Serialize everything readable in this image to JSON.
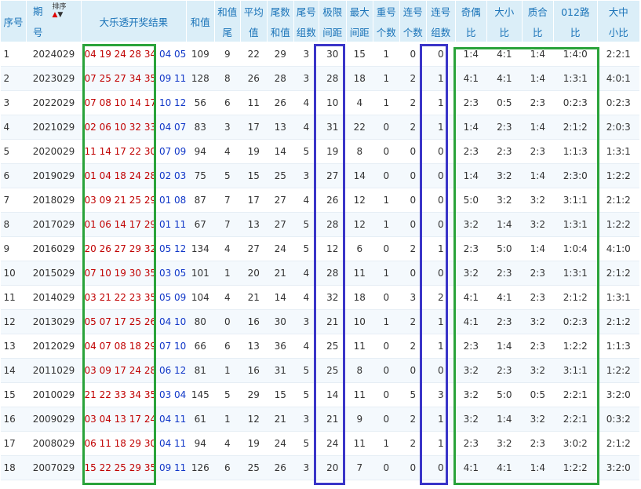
{
  "headers": {
    "seq": "序号",
    "period_top": "期",
    "period_bottom": "号",
    "sort_label": "排序",
    "result": "大乐透开奖结果",
    "sum": "和值",
    "sum_tail_top": "和值",
    "sum_tail_bottom": "尾",
    "avg_top": "平均",
    "avg_bottom": "值",
    "tail_sum_top": "尾数",
    "tail_sum_bottom": "和值",
    "tail_grp_top": "尾号",
    "tail_grp_bottom": "组数",
    "limit_top": "极限",
    "limit_bottom": "间距",
    "max_top": "最大",
    "max_bottom": "间距",
    "repeat_top": "重号",
    "repeat_bottom": "个数",
    "consec_top": "连号",
    "consec_bottom": "个数",
    "consec_grp_top": "连号",
    "consec_grp_bottom": "组数",
    "oddeven_top": "奇偶",
    "oddeven_bottom": "比",
    "bigsmall_top": "大小",
    "bigsmall_bottom": "比",
    "primecomp_top": "质合",
    "primecomp_bottom": "比",
    "route_top": "012路",
    "route_bottom": "比",
    "bms_top": "大中",
    "bms_bottom": "小比"
  },
  "rows": [
    {
      "seq": "1",
      "period": "2024029",
      "front": "04 19 24 28 34",
      "back": "04 05",
      "sum": "109",
      "sum_tail": "9",
      "avg": "22",
      "tail_sum": "29",
      "tail_grp": "3",
      "limit": "30",
      "max": "15",
      "repeat": "1",
      "consec": "0",
      "consec_grp": "0",
      "oe": "1:4",
      "bs": "4:1",
      "pc": "1:4",
      "route": "1:4:0",
      "bms": "2:2:1"
    },
    {
      "seq": "2",
      "period": "2023029",
      "front": "07 25 27 34 35",
      "back": "09 11",
      "sum": "128",
      "sum_tail": "8",
      "avg": "26",
      "tail_sum": "28",
      "tail_grp": "3",
      "limit": "28",
      "max": "18",
      "repeat": "1",
      "consec": "2",
      "consec_grp": "1",
      "oe": "4:1",
      "bs": "4:1",
      "pc": "1:4",
      "route": "1:3:1",
      "bms": "4:0:1"
    },
    {
      "seq": "3",
      "period": "2022029",
      "front": "07 08 10 14 17",
      "back": "10 12",
      "sum": "56",
      "sum_tail": "6",
      "avg": "11",
      "tail_sum": "26",
      "tail_grp": "4",
      "limit": "10",
      "max": "4",
      "repeat": "1",
      "consec": "2",
      "consec_grp": "1",
      "oe": "2:3",
      "bs": "0:5",
      "pc": "2:3",
      "route": "0:2:3",
      "bms": "0:2:3"
    },
    {
      "seq": "4",
      "period": "2021029",
      "front": "02 06 10 32 33",
      "back": "04 07",
      "sum": "83",
      "sum_tail": "3",
      "avg": "17",
      "tail_sum": "13",
      "tail_grp": "4",
      "limit": "31",
      "max": "22",
      "repeat": "0",
      "consec": "2",
      "consec_grp": "1",
      "oe": "1:4",
      "bs": "2:3",
      "pc": "1:4",
      "route": "2:1:2",
      "bms": "2:0:3"
    },
    {
      "seq": "5",
      "period": "2020029",
      "front": "11 14 17 22 30",
      "back": "07 09",
      "sum": "94",
      "sum_tail": "4",
      "avg": "19",
      "tail_sum": "14",
      "tail_grp": "5",
      "limit": "19",
      "max": "8",
      "repeat": "0",
      "consec": "0",
      "consec_grp": "0",
      "oe": "2:3",
      "bs": "2:3",
      "pc": "2:3",
      "route": "1:1:3",
      "bms": "1:3:1"
    },
    {
      "seq": "6",
      "period": "2019029",
      "front": "01 04 18 24 28",
      "back": "02 03",
      "sum": "75",
      "sum_tail": "5",
      "avg": "15",
      "tail_sum": "25",
      "tail_grp": "3",
      "limit": "27",
      "max": "14",
      "repeat": "0",
      "consec": "0",
      "consec_grp": "0",
      "oe": "1:4",
      "bs": "3:2",
      "pc": "1:4",
      "route": "2:3:0",
      "bms": "1:2:2"
    },
    {
      "seq": "7",
      "period": "2018029",
      "front": "03 09 21 25 29",
      "back": "01 08",
      "sum": "87",
      "sum_tail": "7",
      "avg": "17",
      "tail_sum": "27",
      "tail_grp": "4",
      "limit": "26",
      "max": "12",
      "repeat": "1",
      "consec": "0",
      "consec_grp": "0",
      "oe": "5:0",
      "bs": "3:2",
      "pc": "3:2",
      "route": "3:1:1",
      "bms": "2:1:2"
    },
    {
      "seq": "8",
      "period": "2017029",
      "front": "01 06 14 17 29",
      "back": "01 11",
      "sum": "67",
      "sum_tail": "7",
      "avg": "13",
      "tail_sum": "27",
      "tail_grp": "5",
      "limit": "28",
      "max": "12",
      "repeat": "1",
      "consec": "0",
      "consec_grp": "0",
      "oe": "3:2",
      "bs": "1:4",
      "pc": "3:2",
      "route": "1:3:1",
      "bms": "1:2:2"
    },
    {
      "seq": "9",
      "period": "2016029",
      "front": "20 26 27 29 32",
      "back": "05 12",
      "sum": "134",
      "sum_tail": "4",
      "avg": "27",
      "tail_sum": "24",
      "tail_grp": "5",
      "limit": "12",
      "max": "6",
      "repeat": "0",
      "consec": "2",
      "consec_grp": "1",
      "oe": "2:3",
      "bs": "5:0",
      "pc": "1:4",
      "route": "1:0:4",
      "bms": "4:1:0"
    },
    {
      "seq": "10",
      "period": "2015029",
      "front": "07 10 19 30 35",
      "back": "03 05",
      "sum": "101",
      "sum_tail": "1",
      "avg": "20",
      "tail_sum": "21",
      "tail_grp": "4",
      "limit": "28",
      "max": "11",
      "repeat": "1",
      "consec": "0",
      "consec_grp": "0",
      "oe": "3:2",
      "bs": "2:3",
      "pc": "2:3",
      "route": "1:3:1",
      "bms": "2:1:2"
    },
    {
      "seq": "11",
      "period": "2014029",
      "front": "03 21 22 23 35",
      "back": "05 09",
      "sum": "104",
      "sum_tail": "4",
      "avg": "21",
      "tail_sum": "14",
      "tail_grp": "4",
      "limit": "32",
      "max": "18",
      "repeat": "0",
      "consec": "3",
      "consec_grp": "2",
      "oe": "4:1",
      "bs": "4:1",
      "pc": "2:3",
      "route": "2:1:2",
      "bms": "1:3:1"
    },
    {
      "seq": "12",
      "period": "2013029",
      "front": "05 07 17 25 26",
      "back": "04 10",
      "sum": "80",
      "sum_tail": "0",
      "avg": "16",
      "tail_sum": "30",
      "tail_grp": "3",
      "limit": "21",
      "max": "10",
      "repeat": "1",
      "consec": "2",
      "consec_grp": "1",
      "oe": "4:1",
      "bs": "2:3",
      "pc": "3:2",
      "route": "0:2:3",
      "bms": "2:1:2"
    },
    {
      "seq": "13",
      "period": "2012029",
      "front": "04 07 08 18 29",
      "back": "07 10",
      "sum": "66",
      "sum_tail": "6",
      "avg": "13",
      "tail_sum": "36",
      "tail_grp": "4",
      "limit": "25",
      "max": "11",
      "repeat": "0",
      "consec": "2",
      "consec_grp": "1",
      "oe": "2:3",
      "bs": "1:4",
      "pc": "2:3",
      "route": "1:2:2",
      "bms": "1:1:3"
    },
    {
      "seq": "14",
      "period": "2011029",
      "front": "03 09 17 24 28",
      "back": "06 12",
      "sum": "81",
      "sum_tail": "1",
      "avg": "16",
      "tail_sum": "31",
      "tail_grp": "5",
      "limit": "25",
      "max": "8",
      "repeat": "0",
      "consec": "0",
      "consec_grp": "0",
      "oe": "3:2",
      "bs": "2:3",
      "pc": "3:2",
      "route": "3:1:1",
      "bms": "1:2:2"
    },
    {
      "seq": "15",
      "period": "2010029",
      "front": "21 22 33 34 35",
      "back": "03 04",
      "sum": "145",
      "sum_tail": "5",
      "avg": "29",
      "tail_sum": "15",
      "tail_grp": "5",
      "limit": "14",
      "max": "11",
      "repeat": "0",
      "consec": "5",
      "consec_grp": "3",
      "oe": "3:2",
      "bs": "5:0",
      "pc": "0:5",
      "route": "2:2:1",
      "bms": "3:2:0"
    },
    {
      "seq": "16",
      "period": "2009029",
      "front": "03 04 13 17 24",
      "back": "04 11",
      "sum": "61",
      "sum_tail": "1",
      "avg": "12",
      "tail_sum": "21",
      "tail_grp": "3",
      "limit": "21",
      "max": "9",
      "repeat": "0",
      "consec": "2",
      "consec_grp": "1",
      "oe": "3:2",
      "bs": "1:4",
      "pc": "3:2",
      "route": "2:2:1",
      "bms": "0:3:2"
    },
    {
      "seq": "17",
      "period": "2008029",
      "front": "06 11 18 29 30",
      "back": "04 11",
      "sum": "94",
      "sum_tail": "4",
      "avg": "19",
      "tail_sum": "24",
      "tail_grp": "5",
      "limit": "24",
      "max": "11",
      "repeat": "1",
      "consec": "2",
      "consec_grp": "1",
      "oe": "2:3",
      "bs": "3:2",
      "pc": "2:3",
      "route": "3:0:2",
      "bms": "2:1:2"
    },
    {
      "seq": "18",
      "period": "2007029",
      "front": "15 22 25 29 35",
      "back": "09 11",
      "sum": "126",
      "sum_tail": "6",
      "avg": "25",
      "tail_sum": "26",
      "tail_grp": "3",
      "limit": "20",
      "max": "7",
      "repeat": "0",
      "consec": "0",
      "consec_grp": "0",
      "oe": "4:1",
      "bs": "4:1",
      "pc": "1:4",
      "route": "1:2:2",
      "bms": "3:2:0"
    }
  ],
  "colors": {
    "front_numbers": "#c00000",
    "back_numbers": "#1037c8",
    "header_bg": "#dbeef8",
    "header_text": "#1a73b8",
    "highlight_green": "#2aa33a",
    "highlight_blue": "#3a35c8"
  }
}
